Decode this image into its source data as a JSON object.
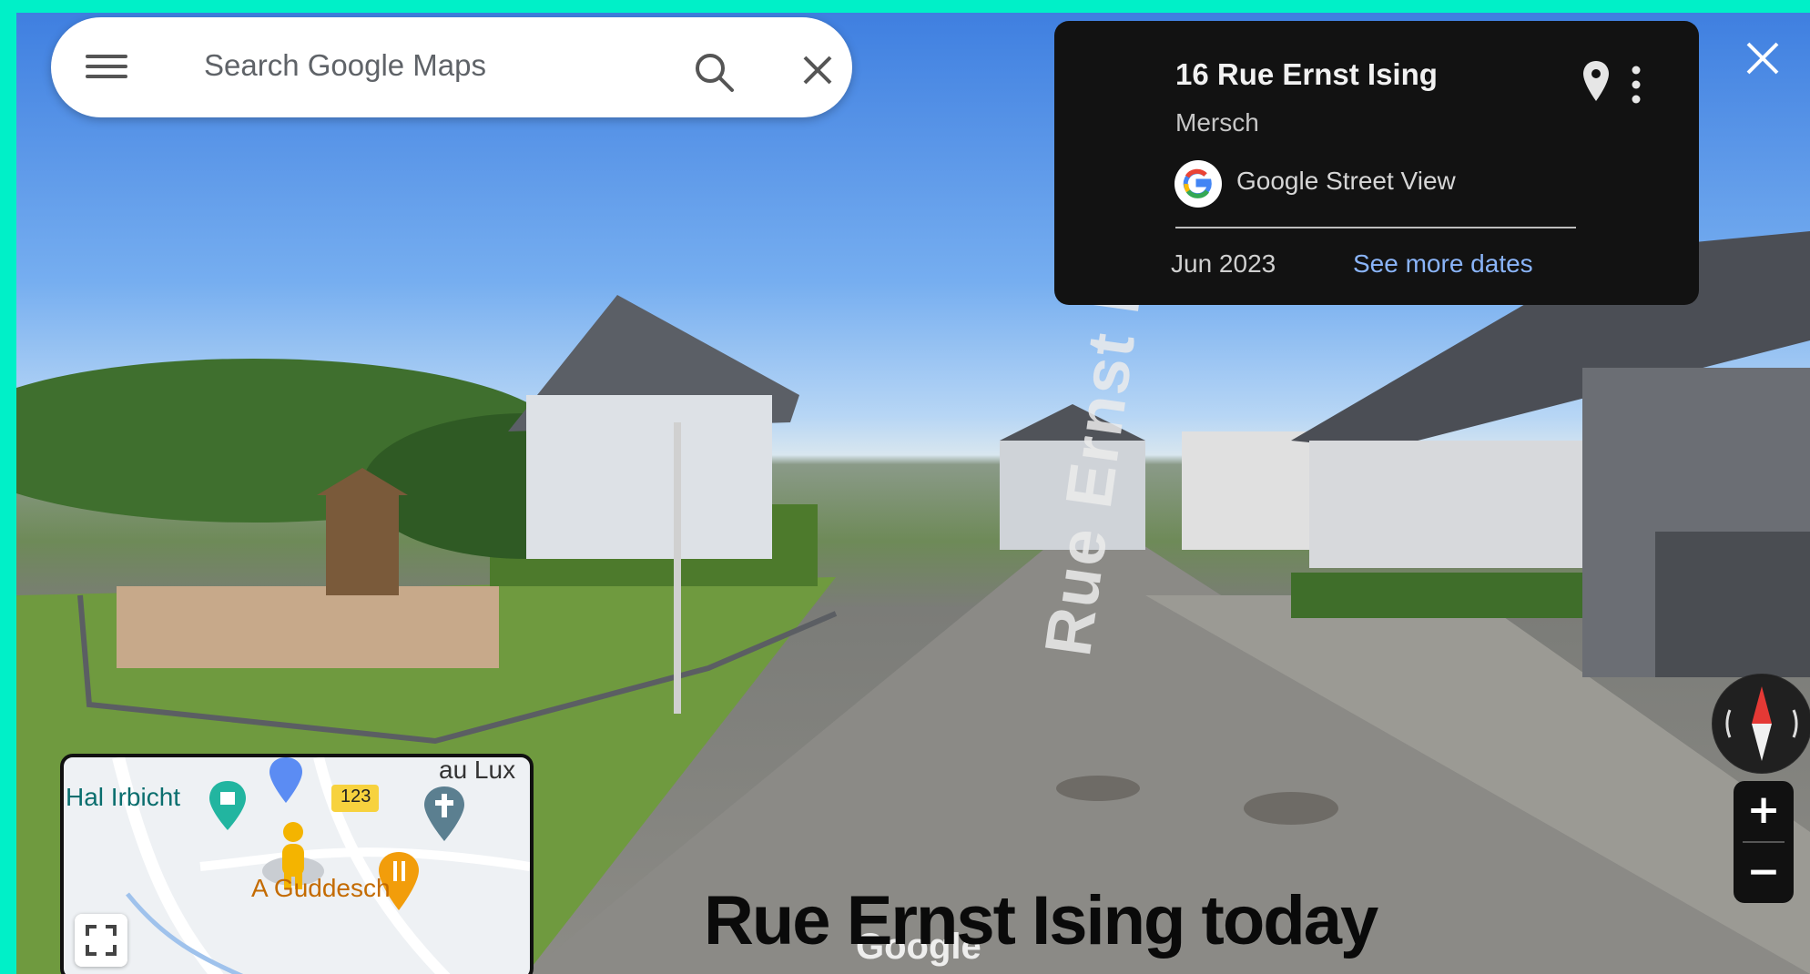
{
  "search": {
    "placeholder": "Search Google Maps"
  },
  "info_panel": {
    "address": "16 Rue Ernst Ising",
    "locality": "Mersch",
    "source": "Google Street View",
    "date": "Jun 2023",
    "more_dates_link": "See more dates"
  },
  "minimap": {
    "labels": [
      "Hal Irbicht",
      "au Lux",
      "123",
      "A Guddesch"
    ]
  },
  "street_view": {
    "painted_street_name": "Rue Ernst Ising",
    "watermark": "Google"
  },
  "caption": "Rue Ernst Ising today",
  "colors": {
    "border": "#00f0c8",
    "link": "#8ab4f8",
    "panel_bg": "#121212"
  },
  "icons": [
    "menu-icon",
    "search-icon",
    "close-icon",
    "location-pin-icon",
    "more-vert-icon",
    "google-logo-icon",
    "compass-icon",
    "zoom-in-icon",
    "zoom-out-icon",
    "expand-icon"
  ]
}
